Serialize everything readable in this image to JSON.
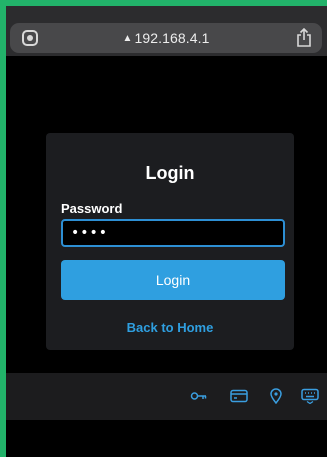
{
  "browser": {
    "url": "192.168.4.1",
    "warning_icon": "warning-triangle-icon",
    "reader_icon": "reader-mode-icon",
    "share_icon": "share-icon"
  },
  "login": {
    "title": "Login",
    "password_label": "Password",
    "password_value": "••••",
    "button_label": "Login",
    "back_link": "Back to Home"
  },
  "keyboard_bar": {
    "icons": [
      "key-icon",
      "credit-card-icon",
      "location-pin-icon",
      "keyboard-icon"
    ]
  },
  "colors": {
    "accent": "#2f9fe0",
    "card_bg": "#1c1d20",
    "page_bg": "#000000"
  }
}
